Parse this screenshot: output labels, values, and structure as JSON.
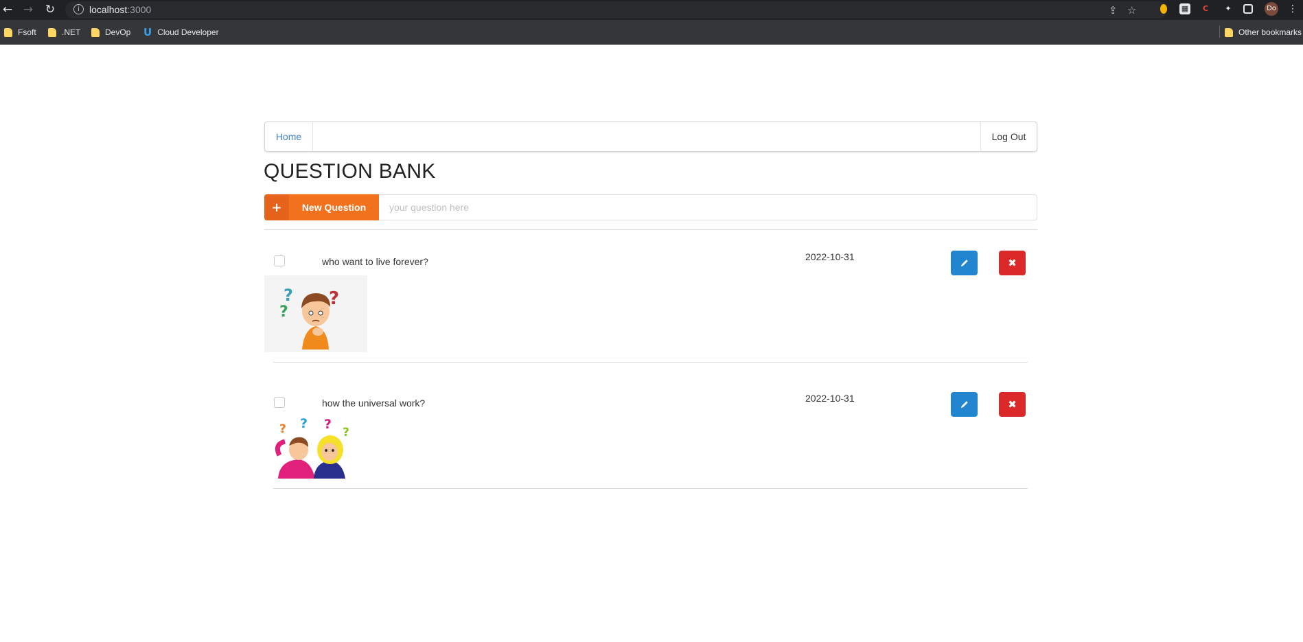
{
  "browser": {
    "url_host": "localhost",
    "url_port": ":3000",
    "bookmarks": [
      "Fsoft",
      ".NET",
      "DevOp",
      "Cloud Developer"
    ],
    "other_bookmarks": "Other bookmarks",
    "profile": "Do"
  },
  "nav": {
    "home": "Home",
    "logout": "Log Out"
  },
  "page": {
    "title": "QUESTION BANK",
    "new_question_label": "New Question",
    "input_placeholder": "your question here"
  },
  "questions": [
    {
      "text": "who want to live forever?",
      "date": "2022-10-31",
      "image": "thinking-boy-illustration"
    },
    {
      "text": "how the universal work?",
      "date": "2022-10-31",
      "image": "confused-couple-illustration"
    }
  ],
  "colors": {
    "primary": "#2185d0",
    "danger": "#db2828",
    "orange": "#f2711c"
  }
}
